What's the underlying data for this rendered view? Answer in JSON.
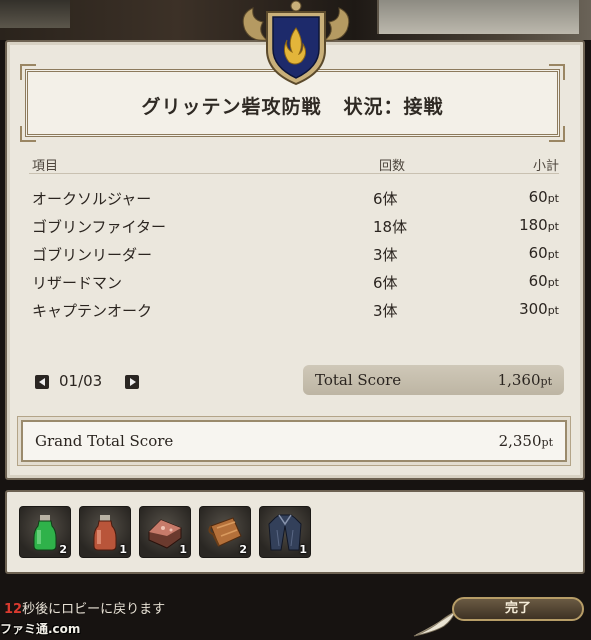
{
  "title": {
    "battle_name": "グリッテン砦攻防戦",
    "status": "状況：接戦"
  },
  "table": {
    "headers": {
      "item": "項目",
      "count": "回数",
      "subtotal": "小計"
    },
    "rows": [
      {
        "name": "オークソルジャー",
        "count": "6体",
        "points": "60",
        "unit": "pt"
      },
      {
        "name": "ゴブリンファイター",
        "count": "18体",
        "points": "180",
        "unit": "pt"
      },
      {
        "name": "ゴブリンリーダー",
        "count": "3体",
        "points": "60",
        "unit": "pt"
      },
      {
        "name": "リザードマン",
        "count": "6体",
        "points": "60",
        "unit": "pt"
      },
      {
        "name": "キャプテンオーク",
        "count": "3体",
        "points": "300",
        "unit": "pt"
      }
    ]
  },
  "pager": {
    "label": "01/03"
  },
  "total": {
    "label": "Total Score",
    "value": "1,360",
    "unit": "pt"
  },
  "grand_total": {
    "label": "Grand Total Score",
    "value": "2,350",
    "unit": "pt"
  },
  "rewards": [
    {
      "icon": "green-potion-icon",
      "qty": "2"
    },
    {
      "icon": "red-potion-icon",
      "qty": "1"
    },
    {
      "icon": "ore-chunk-icon",
      "qty": "1"
    },
    {
      "icon": "leather-roll-icon",
      "qty": "2"
    },
    {
      "icon": "coat-armor-icon",
      "qty": "1"
    }
  ],
  "footer": {
    "countdown": "12",
    "return_text": "秒後にロビーに戻ります",
    "done_label": "完了",
    "watermark": "ファミ通.com"
  },
  "colors": {
    "panel_bg": "#ebe7dd",
    "countdown_red": "#d93a2f",
    "button_gold": "#b79d67"
  }
}
